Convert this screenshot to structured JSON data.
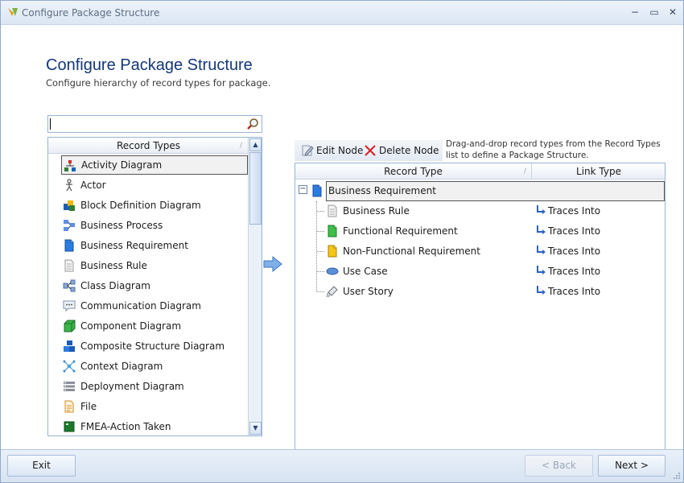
{
  "window": {
    "title": "Configure Package Structure",
    "controls": {
      "minimize": "−",
      "maximize": "▭",
      "close": "✕"
    }
  },
  "header": {
    "title": "Configure Package Structure",
    "subtitle": "Configure hierarchy of record types for package."
  },
  "search": {
    "value": "",
    "placeholder": ""
  },
  "record_types": {
    "header": "Record Types",
    "sort_glyph": "/",
    "items": [
      {
        "label": "Activity Diagram",
        "icon": "activity-diagram-icon",
        "selected": true
      },
      {
        "label": "Actor",
        "icon": "actor-icon"
      },
      {
        "label": "Block Definition Diagram",
        "icon": "block-definition-diagram-icon"
      },
      {
        "label": "Business Process",
        "icon": "business-process-icon"
      },
      {
        "label": "Business Requirement",
        "icon": "business-requirement-icon"
      },
      {
        "label": "Business Rule",
        "icon": "business-rule-icon"
      },
      {
        "label": "Class Diagram",
        "icon": "class-diagram-icon"
      },
      {
        "label": "Communication Diagram",
        "icon": "communication-diagram-icon"
      },
      {
        "label": "Component Diagram",
        "icon": "component-diagram-icon"
      },
      {
        "label": "Composite Structure Diagram",
        "icon": "composite-structure-diagram-icon"
      },
      {
        "label": "Context Diagram",
        "icon": "context-diagram-icon"
      },
      {
        "label": "Deployment Diagram",
        "icon": "deployment-diagram-icon"
      },
      {
        "label": "File",
        "icon": "file-icon"
      },
      {
        "label": "FMEA-Action Taken",
        "icon": "fmea-action-taken-icon"
      }
    ]
  },
  "toolbar": {
    "edit_node": "Edit Node",
    "delete_node": "Delete Node"
  },
  "hint": "Drag-and-drop record types from the Record Types list to define a Package Structure.",
  "structure": {
    "columns": {
      "record_type": "Record Type",
      "link_type": "Link Type",
      "sort_glyph": "/"
    },
    "root": {
      "label": "Business Requirement",
      "expander": "−"
    },
    "children": [
      {
        "label": "Business Rule",
        "icon": "business-rule-icon",
        "link": "Traces Into"
      },
      {
        "label": "Functional Requirement",
        "icon": "functional-requirement-icon",
        "link": "Traces Into"
      },
      {
        "label": "Non-Functional Requirement",
        "icon": "non-functional-requirement-icon",
        "link": "Traces Into"
      },
      {
        "label": "Use Case",
        "icon": "use-case-icon",
        "link": "Traces Into"
      },
      {
        "label": "User Story",
        "icon": "user-story-icon",
        "link": "Traces Into"
      }
    ]
  },
  "footer": {
    "exit": "Exit",
    "back": "< Back",
    "next": "Next >"
  },
  "colors": {
    "title_blue": "#14377a",
    "panel_border": "#97b4d9",
    "link_arrow": "#2a63c8"
  }
}
